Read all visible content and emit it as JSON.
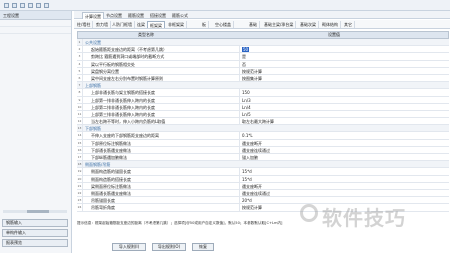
{
  "left_panel": {
    "header": "工程设置",
    "buttons": [
      "钢筋输入",
      "单构件输入",
      "报表预览"
    ]
  },
  "tabs_top": [
    "计算设置",
    "节点设置",
    "箍筋设置",
    "搭接设置",
    "箍筋公式"
  ],
  "tabs_sub": [
    "柱/墙柱",
    "剪力墙",
    "人防门框墙",
    "连梁",
    "框架梁",
    "非框架梁",
    "板",
    "空心楼盖",
    "基础",
    "基础主梁/承台梁",
    "基础次梁",
    "砌体结构",
    "其它"
  ],
  "grid": {
    "col_name": "类型名称",
    "col_value": "设置值",
    "rows": [
      {
        "num": "1",
        "name": "公共设置",
        "value": "",
        "section": true
      },
      {
        "num": "2",
        "name": "起始箍筋距支座边的距离（不考虑第几跳）",
        "value": "50",
        "selected": true
      },
      {
        "num": "3",
        "name": "剪跨比 箍筋遇到洞口或端部时的截断方式",
        "value": "是"
      },
      {
        "num": "4",
        "name": "梁以平行板的钢筋相交处",
        "value": "否"
      },
      {
        "num": "5",
        "name": "梁盘钢分离位置",
        "value": "按规范计算"
      },
      {
        "num": "6",
        "name": "梁中间支座左右分别布置时钢筋计算原则",
        "value": "按图集计算"
      },
      {
        "num": "7",
        "name": "上部钢筋",
        "value": "",
        "section": true
      },
      {
        "num": "8",
        "name": "上部非通长筋与架立钢筋的搭接长度",
        "value": "150"
      },
      {
        "num": "9",
        "name": "上部第一排非通长筋伸入跨内的长度",
        "value": "Ln/3"
      },
      {
        "num": "10",
        "name": "上部第二排非通长筋伸入跨内的长度",
        "value": "Ln/4"
      },
      {
        "num": "11",
        "name": "上部第三排非通长筋伸入跨内的长度",
        "value": "Ln/5"
      },
      {
        "num": "12",
        "name": "当左右跨不等时，伸入小跨内负筋的L取值",
        "value": "取左右最大跨计算"
      },
      {
        "num": "13",
        "name": "下部钢筋",
        "value": "",
        "section": true
      },
      {
        "num": "14",
        "name": "不伸入支座的下部钢筋距支座边的距离",
        "value": "0.1*L"
      },
      {
        "num": "15",
        "name": "下部原位标注钢筋做法",
        "value": "遇支座断开"
      },
      {
        "num": "16",
        "name": "下部通长筋遇支座做法",
        "value": "遇支座连续通过"
      },
      {
        "num": "17",
        "name": "下部纵筋遇加腋做法",
        "value": "锚入加腋"
      },
      {
        "num": "18",
        "name": "侧面钢筋/吊筋",
        "value": "",
        "section": true
      },
      {
        "num": "19",
        "name": "侧面构造筋的锚固长度",
        "value": "15*d"
      },
      {
        "num": "20",
        "name": "侧面构造筋的搭接长度",
        "value": "15*d"
      },
      {
        "num": "21",
        "name": "梁侧面原位标注筋做法",
        "value": "遇支座断开"
      },
      {
        "num": "22",
        "name": "侧面通长筋遇支座做法",
        "value": "遇支座连续通过"
      },
      {
        "num": "23",
        "name": "吊筋锚固长度",
        "value": "20*d"
      },
      {
        "num": "24",
        "name": "吊筋弯折角度",
        "value": "按规范计算"
      }
    ]
  },
  "hint": "提示信息：框架起始箍筋距支座边的距离（不考虑第几跳）；选择项[@50或用户自定义数值]，默认50；本参数默认取[C+Lm内]",
  "bottom_buttons": [
    "导入规则(I)",
    "导出规则(O)",
    "恢复"
  ],
  "watermark": "软件技巧"
}
